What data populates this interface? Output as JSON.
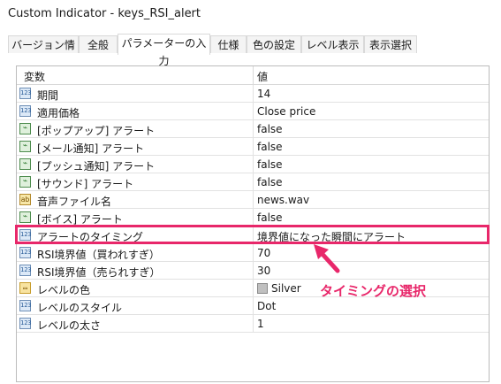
{
  "window": {
    "title": "Custom Indicator - keys_RSI_alert"
  },
  "tabs": [
    {
      "label": "バージョン情報"
    },
    {
      "label": "全般"
    },
    {
      "label": "パラメーターの入力"
    },
    {
      "label": "仕様"
    },
    {
      "label": "色の設定"
    },
    {
      "label": "レベル表示"
    },
    {
      "label": "表示選択"
    }
  ],
  "active_tab": "パラメーターの入力",
  "table": {
    "headers": {
      "variable": "変数",
      "value": "値"
    },
    "rows": [
      {
        "icon": "123-icon",
        "name": "期間",
        "value": "14"
      },
      {
        "icon": "123-icon",
        "name": "適用価格",
        "value": "Close price"
      },
      {
        "icon": "alert-icon",
        "name": "[ポップアップ] アラート",
        "value": "false"
      },
      {
        "icon": "alert-icon",
        "name": "[メール通知] アラート",
        "value": "false"
      },
      {
        "icon": "alert-icon",
        "name": "[プッシュ通知] アラート",
        "value": "false"
      },
      {
        "icon": "alert-icon",
        "name": "[サウンド] アラート",
        "value": "false"
      },
      {
        "icon": "string-icon",
        "name": "音声ファイル名",
        "value": "news.wav"
      },
      {
        "icon": "alert-icon",
        "name": "[ボイス] アラート",
        "value": "false"
      },
      {
        "icon": "123-icon",
        "name": "アラートのタイミング",
        "value": "境界値になった瞬間にアラート"
      },
      {
        "icon": "123-icon",
        "name": "RSI境界値（買われすぎ）",
        "value": "70"
      },
      {
        "icon": "123-icon",
        "name": "RSI境界値（売られすぎ）",
        "value": "30"
      },
      {
        "icon": "color-icon",
        "name": "レベルの色",
        "value": "Silver"
      },
      {
        "icon": "123-icon",
        "name": "レベルのスタイル",
        "value": "Dot"
      },
      {
        "icon": "123-icon",
        "name": "レベルの太さ",
        "value": "1"
      }
    ]
  },
  "annotation": {
    "text": "タイミングの選択",
    "color": "#e8276a"
  },
  "colors": {
    "highlight": "#e8276a",
    "silver_swatch": "#c0c0c0"
  }
}
